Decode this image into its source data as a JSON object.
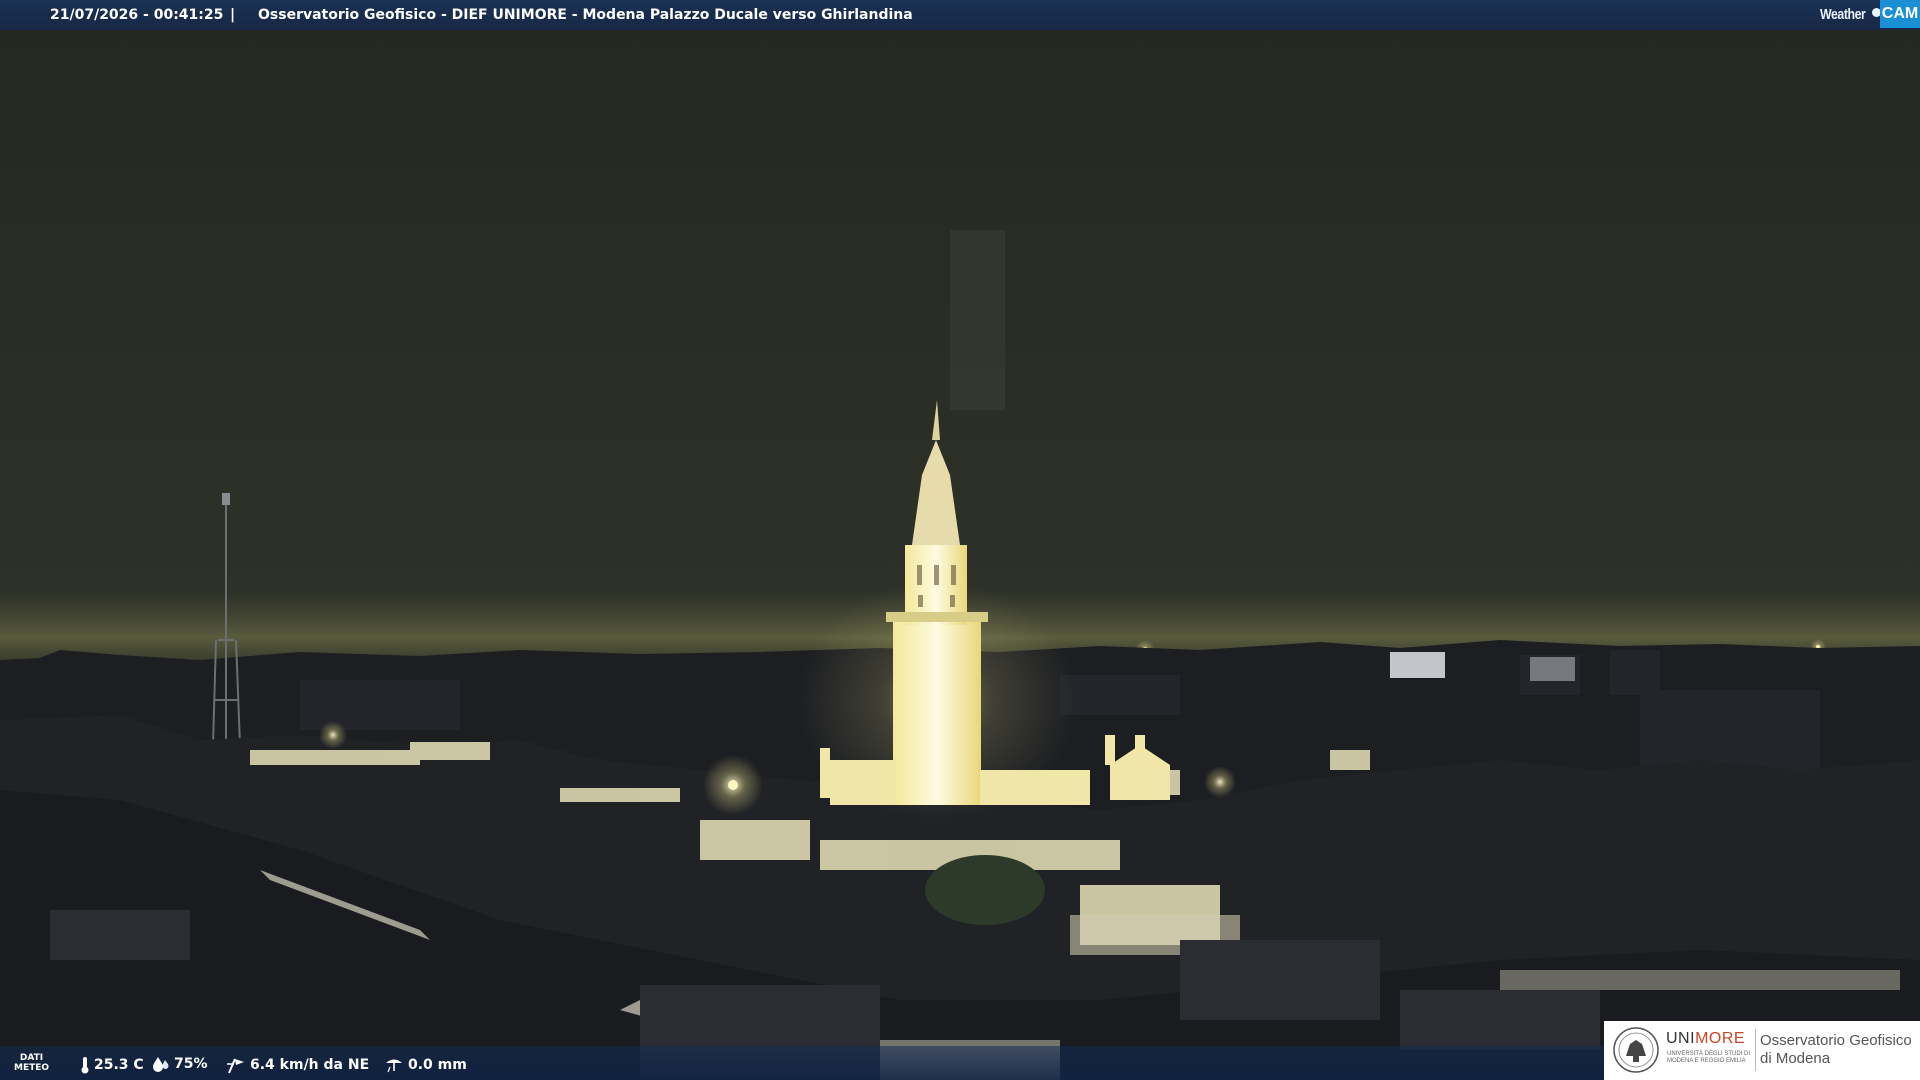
{
  "header": {
    "datetime": "21/07/2026 - 00:41:25",
    "separator": "|",
    "title": "Osservatorio Geofisico - DIEF UNIMORE - Modena Palazzo Ducale verso Ghirlandina",
    "logo_weather": "Weather",
    "logo_cam": "CAM"
  },
  "weather": {
    "label_line1": "DATI",
    "label_line2": "METEO",
    "temperature": "25.3 C",
    "humidity": "75%",
    "wind": "6.4 km/h da NE",
    "rain": "0.0 mm",
    "icons": [
      "thermometer-icon",
      "humidity-drop-icon",
      "wind-vane-icon",
      "rain-gauge-icon"
    ]
  },
  "partner": {
    "name_part1": "UNI",
    "name_part2": "MORE",
    "subtitle": "UNIVERSITÀ DEGLI STUDI DI MODENA E REGGIO EMILIA",
    "observatory_line1": "Osservatorio Geofisico",
    "observatory_line2": "di Modena"
  },
  "colors": {
    "sky": "#2a2e27",
    "tower_light": "#fff6c9",
    "header_bar": "#1c3760",
    "cam_blue": "#1a8fd6",
    "unimore_red": "#c74627"
  }
}
